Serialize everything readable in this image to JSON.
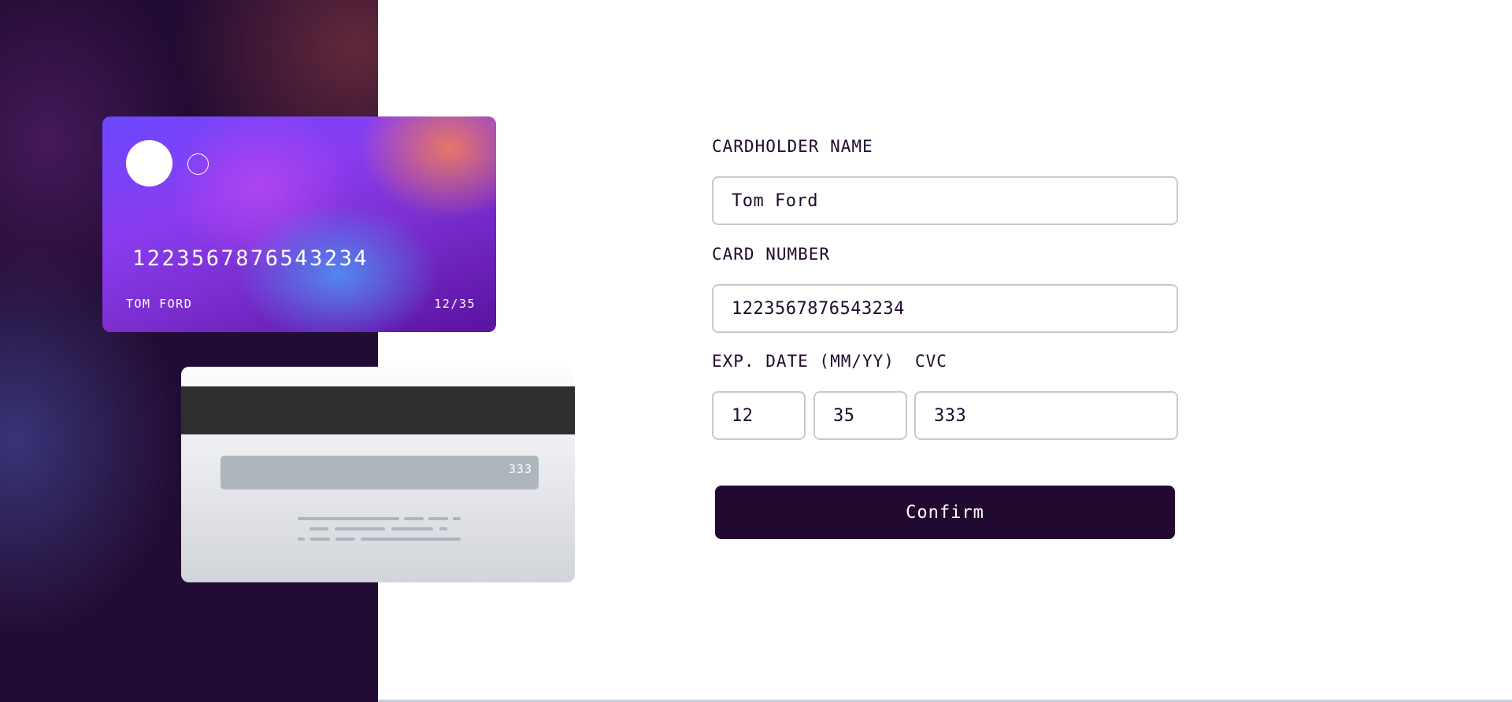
{
  "card_front": {
    "number": "1223567876543234",
    "name": "TOM FORD",
    "expiry": "12/35"
  },
  "card_back": {
    "cvc": "333"
  },
  "form": {
    "cardholder_label": "CARDHOLDER NAME",
    "cardholder_value": "Tom Ford",
    "card_number_label": "CARD NUMBER",
    "card_number_value": "1223567876543234",
    "exp_label": "EXP. DATE (MM/YY)",
    "exp_month_value": "12",
    "exp_year_value": "35",
    "cvc_label": "CVC",
    "cvc_value": "333",
    "confirm_label": "Confirm"
  },
  "colors": {
    "dark_violet": "#21092f",
    "input_border": "#c9c9cc",
    "panel_background": "#230c33"
  }
}
